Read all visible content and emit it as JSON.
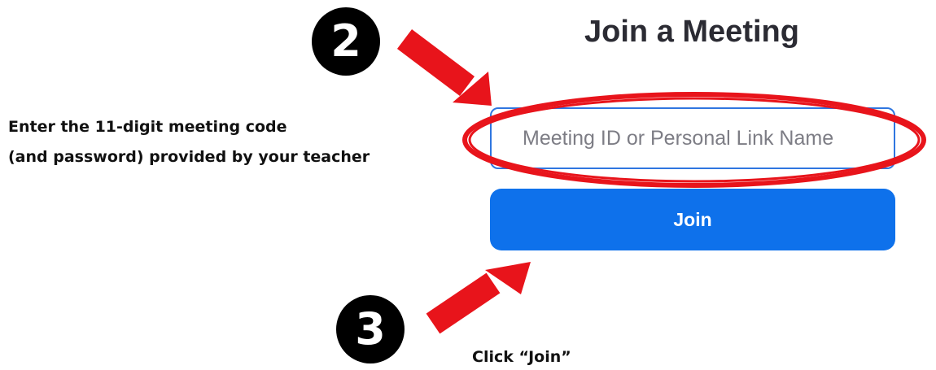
{
  "page": {
    "title": "Join a Meeting"
  },
  "form": {
    "meeting_input": {
      "placeholder": "Meeting ID or Personal Link Name",
      "value": ""
    },
    "join_button_label": "Join"
  },
  "annotations": {
    "step_2_number": "2",
    "step_3_number": "3",
    "instruction_line_1": "Enter the 11-digit meeting code",
    "instruction_line_2": "(and password) provided by your teacher",
    "click_instruction": "Click “Join”"
  },
  "colors": {
    "accent": "#0e71eb",
    "input_border": "#2f76e0",
    "highlight_red": "#e8141b",
    "badge": "#000000",
    "title_text": "#2b2b33"
  }
}
